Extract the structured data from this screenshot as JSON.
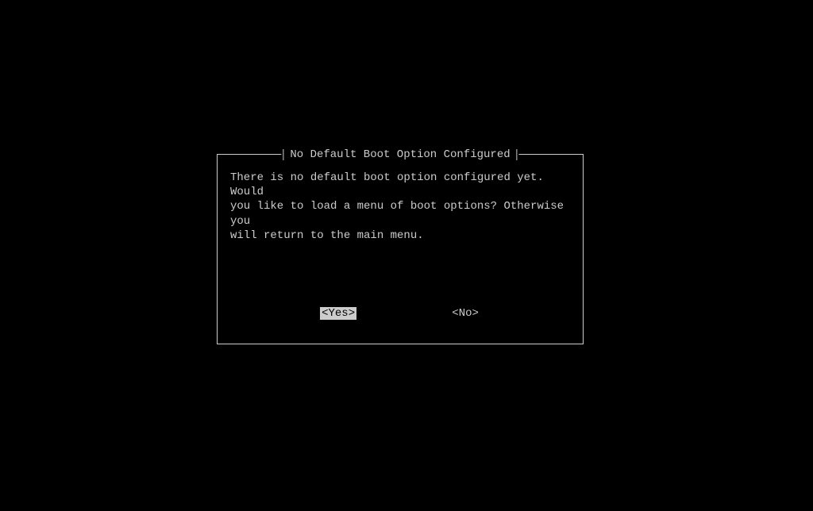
{
  "dialog": {
    "title": "No Default Boot Option Configured",
    "message": "There is no default boot option configured yet. Would\nyou like to load a menu of boot options? Otherwise you\nwill return to the main menu.",
    "buttons": {
      "yes": "<Yes>",
      "no": "<No>"
    },
    "selected_button": "yes"
  }
}
